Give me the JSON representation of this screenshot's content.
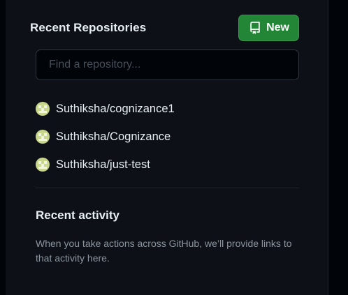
{
  "repositories": {
    "title": "Recent Repositories",
    "new_button_label": "New",
    "search_placeholder": "Find a repository...",
    "items": [
      {
        "name": "Suthiksha/cognizance1",
        "avatar_icon": "identicon-avatar"
      },
      {
        "name": "Suthiksha/Cognizance",
        "avatar_icon": "identicon-avatar"
      },
      {
        "name": "Suthiksha/just-test",
        "avatar_icon": "identicon-avatar"
      }
    ]
  },
  "activity": {
    "title": "Recent activity",
    "description": "When you take actions across GitHub, we’ll provide links to that activity here."
  },
  "colors": {
    "page_bg": "#010409",
    "sidebar_bg": "#0d1117",
    "primary_button": "#238636",
    "text": "#e6edf3",
    "muted_text": "#8b949e",
    "border": "#30363d"
  },
  "icons": {
    "new_button": "repo-icon"
  }
}
